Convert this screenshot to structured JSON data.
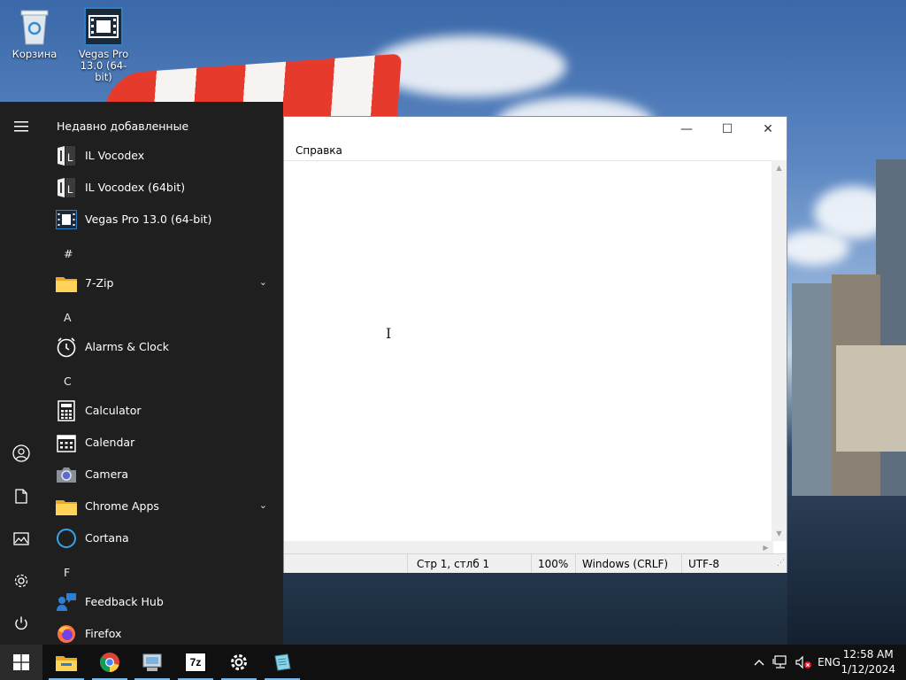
{
  "desktop": {
    "icons": [
      {
        "label": "Корзина",
        "icon": "recycle-bin-icon"
      },
      {
        "label": "Vegas Pro 13.0 (64-bit)",
        "icon": "vegas-pro-icon"
      }
    ]
  },
  "notepad": {
    "menu": {
      "help": "Справка"
    },
    "status": {
      "position": "Стр 1, стлб 1",
      "zoom": "100%",
      "line_endings": "Windows (CRLF)",
      "encoding": "UTF-8"
    }
  },
  "start_menu": {
    "recent_header": "Недавно добавленные",
    "recent": [
      {
        "label": "IL Vocodex",
        "icon": "il-vocodex-icon"
      },
      {
        "label": "IL Vocodex (64bit)",
        "icon": "il-vocodex-icon"
      },
      {
        "label": "Vegas Pro 13.0 (64-bit)",
        "icon": "vegas-pro-icon"
      }
    ],
    "groups": [
      {
        "letter": "#",
        "items": [
          {
            "label": "7-Zip",
            "icon": "folder-icon",
            "expandable": true
          }
        ]
      },
      {
        "letter": "A",
        "items": [
          {
            "label": "Alarms & Clock",
            "icon": "alarm-clock-icon"
          }
        ]
      },
      {
        "letter": "C",
        "items": [
          {
            "label": "Calculator",
            "icon": "calculator-icon"
          },
          {
            "label": "Calendar",
            "icon": "calendar-icon"
          },
          {
            "label": "Camera",
            "icon": "camera-icon"
          },
          {
            "label": "Chrome Apps",
            "icon": "folder-icon",
            "expandable": true
          },
          {
            "label": "Cortana",
            "icon": "cortana-icon"
          }
        ]
      },
      {
        "letter": "F",
        "items": [
          {
            "label": "Feedback Hub",
            "icon": "feedback-hub-icon"
          },
          {
            "label": "Firefox",
            "icon": "firefox-icon"
          }
        ]
      }
    ]
  },
  "taskbar": {
    "apps": [
      "file-explorer-icon",
      "chrome-icon",
      "control-panel-icon",
      "7zip-icon",
      "settings-icon",
      "notepad-icon"
    ],
    "language": "ENG",
    "time": "12:58 AM",
    "date": "1/12/2024"
  },
  "colors": {
    "accent": "#76b9ed",
    "start_bg": "#1f1f1f",
    "taskbar_bg": "#101010"
  }
}
